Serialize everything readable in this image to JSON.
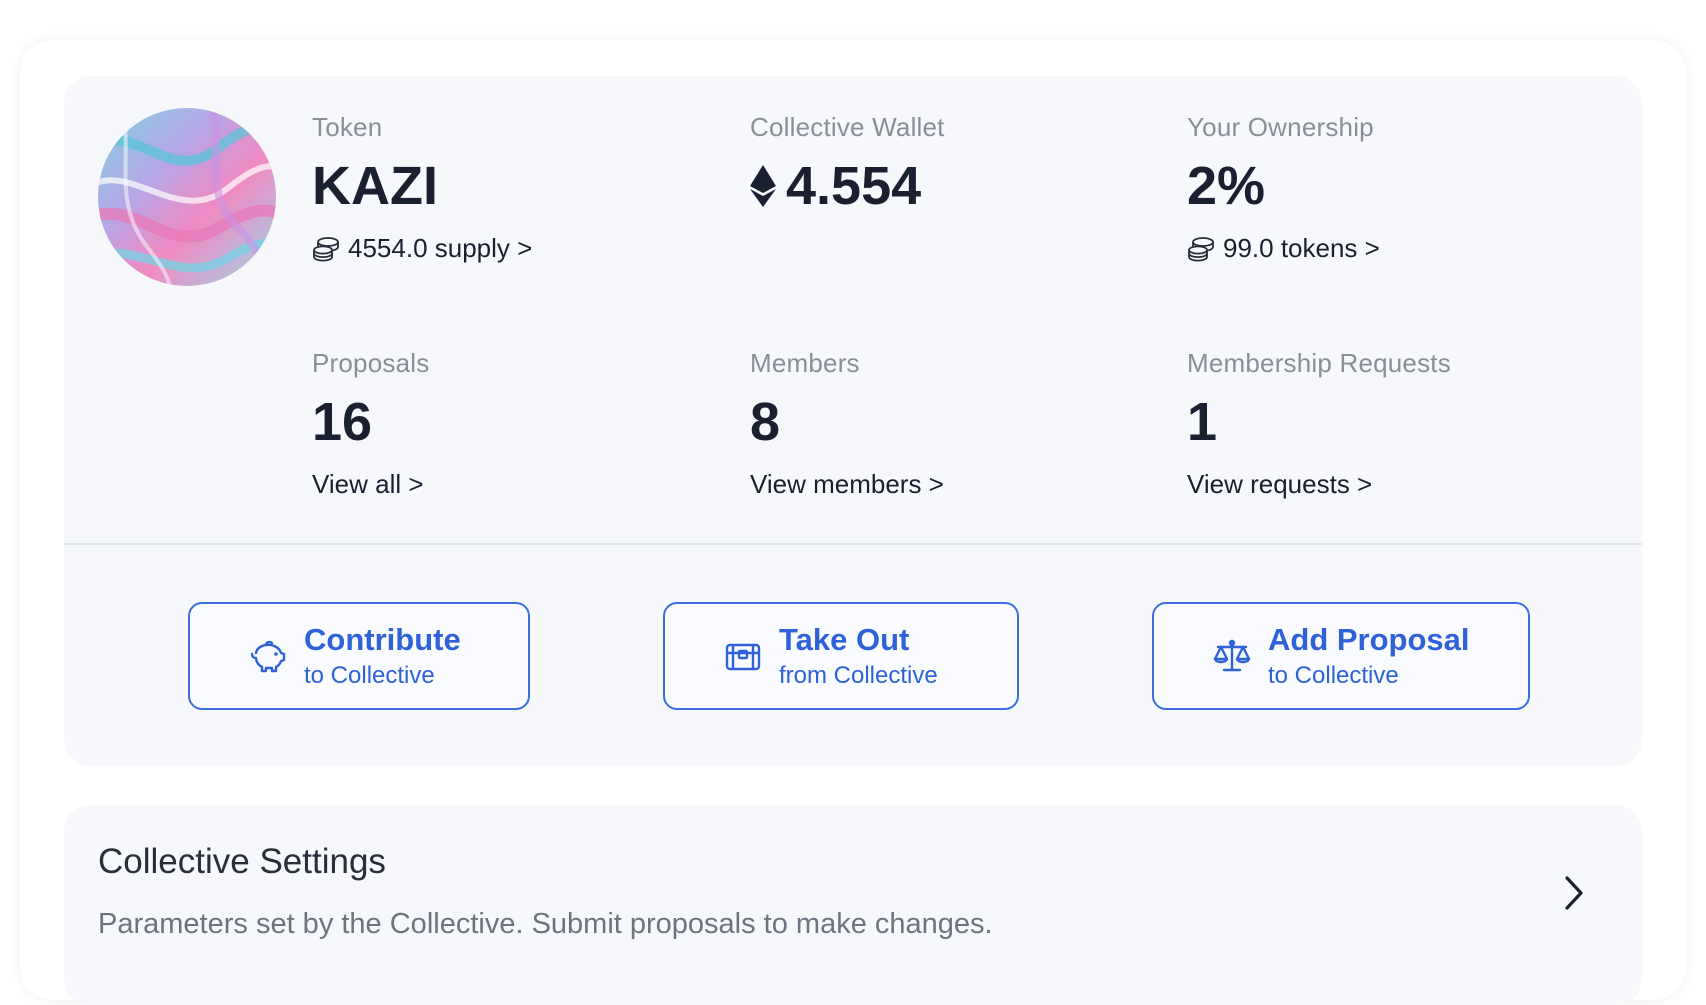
{
  "token": {
    "label": "Token",
    "value": "KAZI",
    "supply_link": "4554.0 supply >"
  },
  "wallet": {
    "label": "Collective Wallet",
    "value": "4.554",
    "currency_icon": "ethereum-icon"
  },
  "ownership": {
    "label": "Your Ownership",
    "value": "2%",
    "tokens_link": "99.0 tokens >"
  },
  "proposals": {
    "label": "Proposals",
    "value": "16",
    "link": "View all >"
  },
  "members": {
    "label": "Members",
    "value": "8",
    "link": "View members >"
  },
  "requests": {
    "label": "Membership Requests",
    "value": "1",
    "link": "View requests >"
  },
  "actions": {
    "contribute": {
      "title": "Contribute",
      "subtitle": "to Collective",
      "icon": "piggy-bank-icon"
    },
    "take_out": {
      "title": "Take Out",
      "subtitle": "from Collective",
      "icon": "treasure-chest-icon"
    },
    "add_proposal": {
      "title": "Add Proposal",
      "subtitle": "to Collective",
      "icon": "scales-icon"
    }
  },
  "settings": {
    "title": "Collective Settings",
    "description": "Parameters set by the Collective. Submit proposals to make changes."
  },
  "colors": {
    "accent": "#2f62d9",
    "card_bg": "#f6f8fb",
    "label_gray": "#8b8e98",
    "text_dark": "#1b2030"
  }
}
